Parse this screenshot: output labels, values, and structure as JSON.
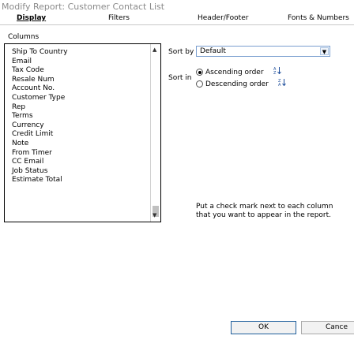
{
  "window": {
    "title": "Modify Report: Customer Contact List"
  },
  "tabs": [
    {
      "label": "Display"
    },
    {
      "label": "Filters"
    },
    {
      "label": "Header/Footer"
    },
    {
      "label": "Fonts & Numbers"
    }
  ],
  "columns": {
    "label": "Columns",
    "items": [
      "Ship To Country",
      "Email",
      "Tax Code",
      "Resale Num",
      "Account No.",
      "Customer Type",
      "Rep",
      "Terms",
      "Currency",
      "Credit Limit",
      "Note",
      "From Timer",
      "CC Email",
      "Job Status",
      "Estimate Total"
    ]
  },
  "sort": {
    "by_label": "Sort by",
    "by_value": "Default",
    "in_label": "Sort in",
    "ascending_label": "Ascending order",
    "descending_label": "Descending order",
    "selected": "ascending"
  },
  "hint": {
    "line1": "Put a check mark next to each column",
    "line2": "that you want to appear in the report."
  },
  "buttons": {
    "ok": "OK",
    "cancel": "Cance"
  }
}
